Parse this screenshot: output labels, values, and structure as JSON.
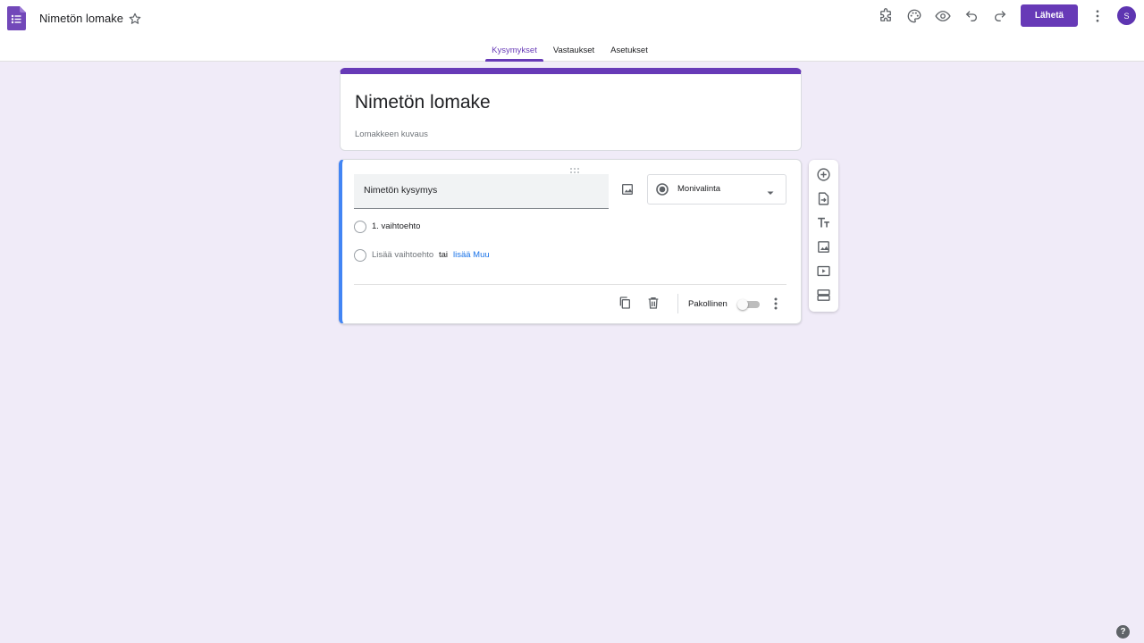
{
  "header": {
    "title": "Nimetön lomake",
    "send_label": "Lähetä",
    "avatar_letter": "S",
    "tabs": [
      {
        "label": "Kysymykset",
        "active": true
      },
      {
        "label": "Vastaukset",
        "active": false
      },
      {
        "label": "Asetukset",
        "active": false
      }
    ],
    "tool_icons": [
      "addon-icon",
      "palette-icon",
      "preview-eye-icon",
      "undo-icon",
      "redo-icon",
      "more-vert-icon"
    ]
  },
  "form": {
    "title": "Nimetön lomake",
    "description_placeholder": "Lomakkeen kuvaus"
  },
  "question": {
    "title": "Nimetön kysymys",
    "type": "Monivalinta",
    "options": [
      "1. vaihtoehto"
    ],
    "add_option_label": "Lisää vaihtoehto",
    "or_label": "tai",
    "add_other_label": "lisää Muu",
    "required_label": "Pakollinen",
    "required": false
  },
  "side_toolbar": {
    "icons": [
      "add-question-icon",
      "import-questions-icon",
      "add-title-icon",
      "add-image-icon",
      "add-video-icon",
      "add-section-icon"
    ]
  },
  "colors": {
    "accent": "#673ab7",
    "background": "#f0ebf8",
    "active_question_border": "#4285f4",
    "link": "#1a73e8"
  }
}
